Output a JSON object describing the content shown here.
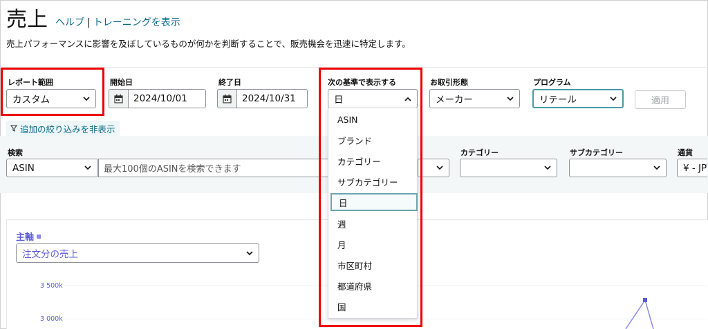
{
  "header": {
    "title": "売上",
    "help_link": "ヘルプ",
    "separator": "|",
    "training_link": "トレーニングを表示",
    "description": "売上パフォーマンスに影響を及ぼしているものが何かを判断することで、販売機会を迅速に特定します。"
  },
  "controls": {
    "report_range": {
      "label": "レポート範囲",
      "value": "カスタム"
    },
    "start_date": {
      "label": "開始日",
      "value": "2024/10/01"
    },
    "end_date": {
      "label": "終了日",
      "value": "2024/10/31"
    },
    "display_by": {
      "label": "次の基準で表示する",
      "value": "日"
    },
    "business_type": {
      "label": "お取引形態",
      "value": "メーカー"
    },
    "program": {
      "label": "プログラム",
      "value": "リテール"
    },
    "apply_label": "適用"
  },
  "filter_toggle": "追加の絞り込みを非表示",
  "filters": {
    "search_label": "検索",
    "search_type": "ASIN",
    "search_placeholder": "最大100個のASINを検索できます",
    "category_label": "カテゴリー",
    "category_value": "",
    "subcategory_label": "サブカテゴリー",
    "subcategory_value": "",
    "currency_label": "通貨",
    "currency_value": "¥ - JPY"
  },
  "chart": {
    "axis_label": "主軸",
    "metric_value": "注文分の売上",
    "ticks": [
      "3 500k",
      "3 000k"
    ]
  },
  "dropdown": {
    "selected": "日",
    "options": [
      "ASIN",
      "ブランド",
      "カテゴリー",
      "サブカテゴリー",
      "日",
      "週",
      "月",
      "市区町村",
      "都道府県",
      "国"
    ]
  },
  "colors": {
    "link": "#0a6b8a",
    "highlight": "#e00000",
    "chart_series": "#5b5bd6",
    "selected_border": "#6aa5ae"
  }
}
